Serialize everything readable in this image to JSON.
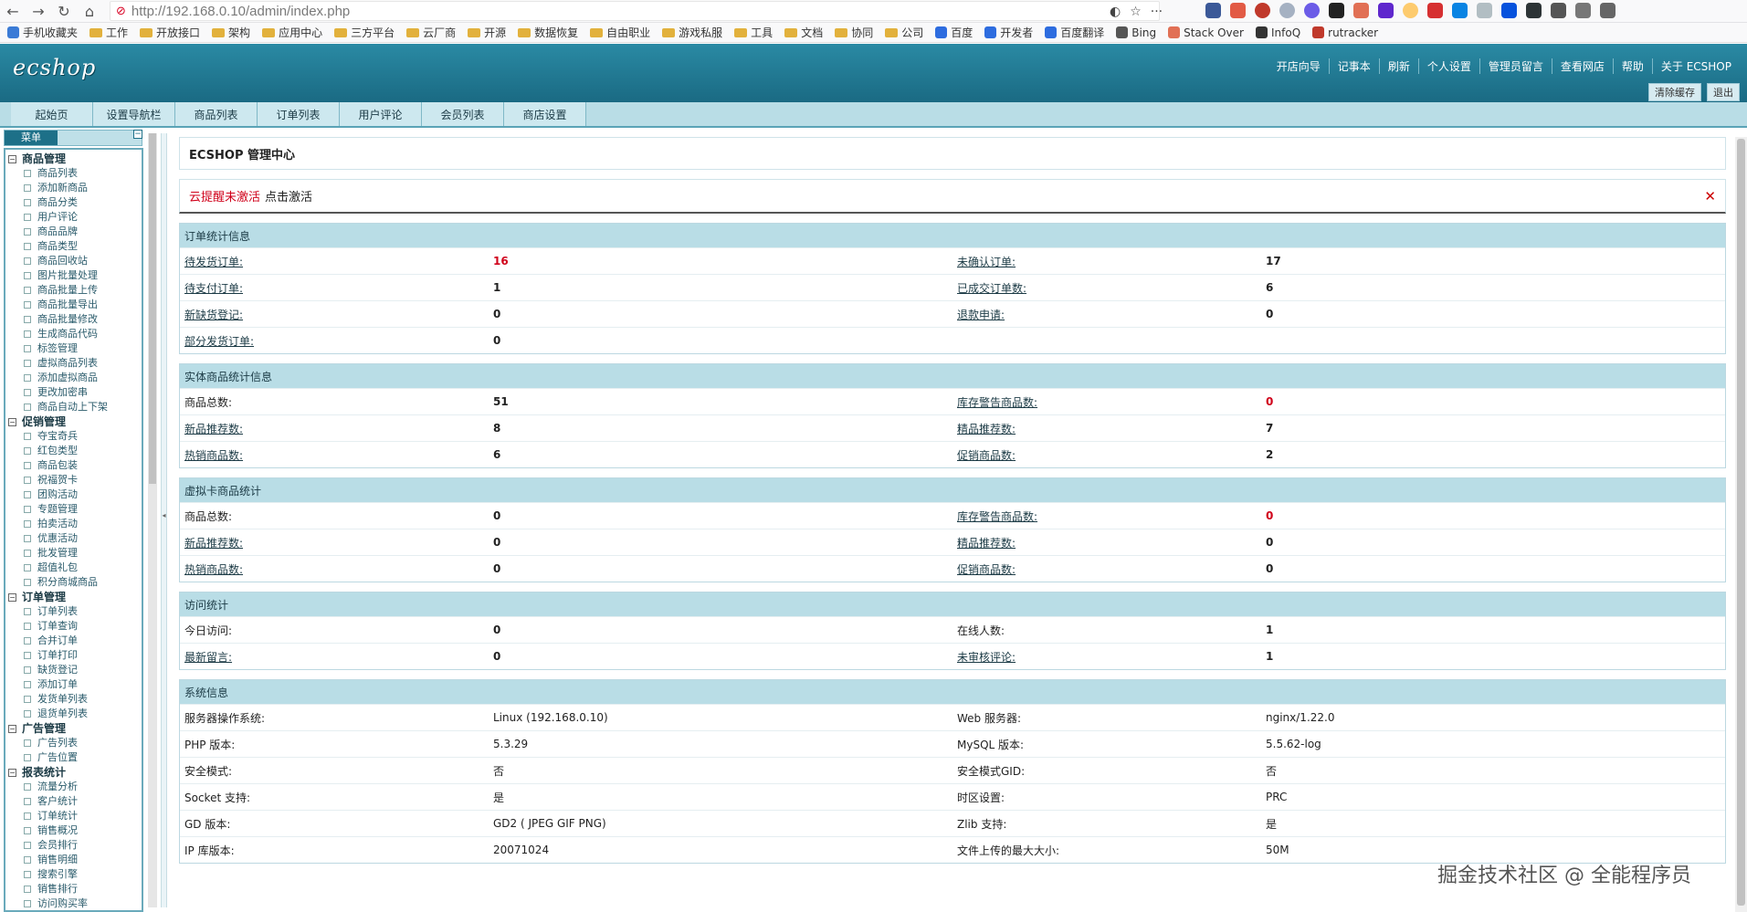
{
  "browser": {
    "url": "http://192.168.0.10/admin/index.php",
    "bookmarks": [
      "手机收藏夹",
      "工作",
      "开放接口",
      "架构",
      "应用中心",
      "三方平台",
      "云厂商",
      "开源",
      "数据恢复",
      "自由职业",
      "游戏私服",
      "工具",
      "文档",
      "协同",
      "公司",
      "百度",
      "开发者",
      "百度翻译",
      "Bing",
      "Stack Over",
      "InfoQ",
      "rutracker"
    ]
  },
  "header": {
    "logo": "ecshop",
    "links": [
      "开店向导",
      "记事本",
      "刷新",
      "个人设置",
      "管理员留言",
      "查看网店",
      "帮助",
      "关于 ECSHOP"
    ],
    "btn_clear": "清除缓存",
    "btn_logout": "退出"
  },
  "tabs": [
    "起始页",
    "设置导航栏",
    "商品列表",
    "订单列表",
    "用户评论",
    "会员列表",
    "商店设置"
  ],
  "sidebar": {
    "title": "菜单",
    "collapse": "−",
    "groups": [
      {
        "title": "商品管理",
        "items": [
          "商品列表",
          "添加新商品",
          "商品分类",
          "用户评论",
          "商品品牌",
          "商品类型",
          "商品回收站",
          "图片批量处理",
          "商品批量上传",
          "商品批量导出",
          "商品批量修改",
          "生成商品代码",
          "标签管理",
          "虚拟商品列表",
          "添加虚拟商品",
          "更改加密串",
          "商品自动上下架"
        ]
      },
      {
        "title": "促销管理",
        "items": [
          "夺宝奇兵",
          "红包类型",
          "商品包装",
          "祝福贺卡",
          "团购活动",
          "专题管理",
          "拍卖活动",
          "优惠活动",
          "批发管理",
          "超值礼包",
          "积分商城商品"
        ]
      },
      {
        "title": "订单管理",
        "items": [
          "订单列表",
          "订单查询",
          "合并订单",
          "订单打印",
          "缺货登记",
          "添加订单",
          "发货单列表",
          "退货单列表"
        ]
      },
      {
        "title": "广告管理",
        "items": [
          "广告列表",
          "广告位置"
        ]
      },
      {
        "title": "报表统计",
        "items": [
          "流量分析",
          "客户统计",
          "订单统计",
          "销售概况",
          "会员排行",
          "销售明细",
          "搜索引擎",
          "销售排行",
          "访问购买率"
        ]
      }
    ]
  },
  "main": {
    "title": "ECSHOP 管理中心",
    "notice_red": "云提醒未激活",
    "notice_text": "点击激活",
    "close": "✕",
    "sections": [
      {
        "title": "订单统计信息",
        "rows": [
          {
            "l1": "待发货订单:",
            "v1": "16",
            "l2": "未确认订单:",
            "v2": "17",
            "link1": true,
            "link2": true,
            "red1": true,
            "red2": false
          },
          {
            "l1": "待支付订单:",
            "v1": "1",
            "l2": "已成交订单数:",
            "v2": "6",
            "link1": true,
            "link2": true
          },
          {
            "l1": "新缺货登记:",
            "v1": "0",
            "l2": "退款申请:",
            "v2": "0",
            "link1": true,
            "link2": true
          },
          {
            "l1": "部分发货订单:",
            "v1": "0",
            "l2": "",
            "v2": "",
            "link1": true,
            "link2": false
          }
        ]
      },
      {
        "title": "实体商品统计信息",
        "rows": [
          {
            "l1": "商品总数:",
            "v1": "51",
            "l2": "库存警告商品数:",
            "v2": "0",
            "link1": false,
            "link2": true,
            "red2": true
          },
          {
            "l1": "新品推荐数:",
            "v1": "8",
            "l2": "精品推荐数:",
            "v2": "7",
            "link1": true,
            "link2": true
          },
          {
            "l1": "热销商品数:",
            "v1": "6",
            "l2": "促销商品数:",
            "v2": "2",
            "link1": true,
            "link2": true
          }
        ]
      },
      {
        "title": "虚拟卡商品统计",
        "rows": [
          {
            "l1": "商品总数:",
            "v1": "0",
            "l2": "库存警告商品数:",
            "v2": "0",
            "link1": false,
            "link2": true,
            "red2": true
          },
          {
            "l1": "新品推荐数:",
            "v1": "0",
            "l2": "精品推荐数:",
            "v2": "0",
            "link1": true,
            "link2": true
          },
          {
            "l1": "热销商品数:",
            "v1": "0",
            "l2": "促销商品数:",
            "v2": "0",
            "link1": true,
            "link2": true
          }
        ]
      },
      {
        "title": "访问统计",
        "rows": [
          {
            "l1": "今日访问:",
            "v1": "0",
            "l2": "在线人数:",
            "v2": "1",
            "link1": false,
            "link2": false
          },
          {
            "l1": "最新留言:",
            "v1": "0",
            "l2": "未审核评论:",
            "v2": "1",
            "link1": true,
            "link2": true
          }
        ]
      },
      {
        "title": "系统信息",
        "plain": true,
        "rows": [
          {
            "l1": "服务器操作系统:",
            "v1": "Linux (192.168.0.10)",
            "l2": "Web 服务器:",
            "v2": "nginx/1.22.0"
          },
          {
            "l1": "PHP 版本:",
            "v1": "5.3.29",
            "l2": "MySQL 版本:",
            "v2": "5.5.62-log"
          },
          {
            "l1": "安全模式:",
            "v1": "否",
            "l2": "安全模式GID:",
            "v2": "否"
          },
          {
            "l1": "Socket 支持:",
            "v1": "是",
            "l2": "时区设置:",
            "v2": "PRC"
          },
          {
            "l1": "GD 版本:",
            "v1": "GD2 ( JPEG GIF PNG)",
            "l2": "Zlib 支持:",
            "v2": "是"
          },
          {
            "l1": "IP 库版本:",
            "v1": "20071024",
            "l2": "文件上传的最大大小:",
            "v2": "50M"
          }
        ]
      }
    ]
  },
  "watermark": "掘金技术社区 @ 全能程序员",
  "colors": {
    "header": "#1d7088",
    "tab": "#b9dde6",
    "accent_red": "#d0021b"
  }
}
